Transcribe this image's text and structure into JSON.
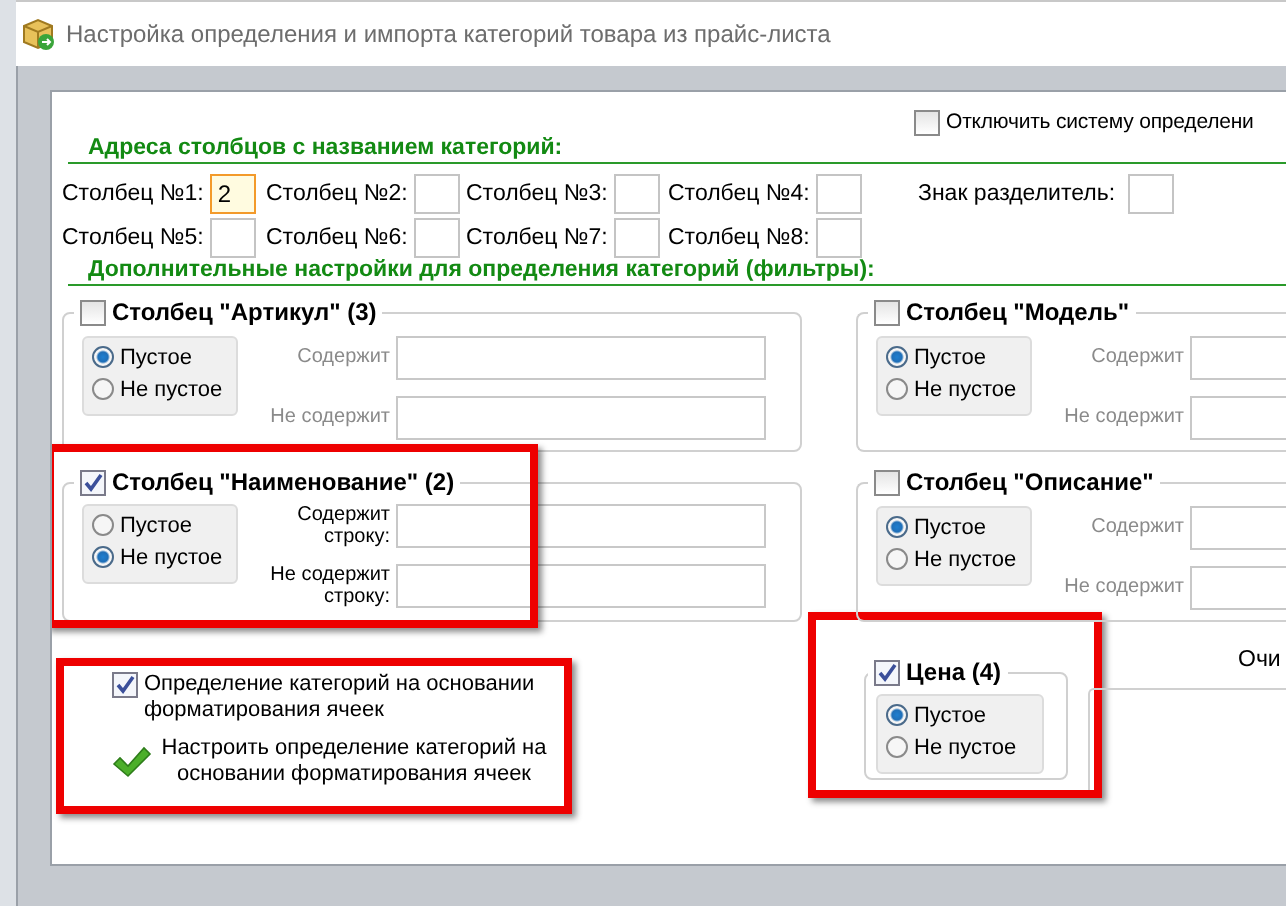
{
  "window": {
    "title": "Настройка определения и импорта категорий товара из прайс-листа"
  },
  "disable_detection": {
    "label": "Отключить систему определени",
    "checked": false
  },
  "columns_section": {
    "title": "Адреса столбцов с названием категорий:",
    "fields": [
      {
        "label": "Столбец №1:",
        "value": "2",
        "focused": true
      },
      {
        "label": "Столбец №2:",
        "focused": false
      },
      {
        "label": "Столбец №3:",
        "focused": false
      },
      {
        "label": "Столбец №4:",
        "focused": false
      },
      {
        "label": "Столбец №5:",
        "focused": false
      },
      {
        "label": "Столбец №6:",
        "focused": false
      },
      {
        "label": "Столбец №7:",
        "focused": false
      },
      {
        "label": "Столбец №8:",
        "focused": false
      }
    ],
    "separator": {
      "label": "Знак разделитель:"
    }
  },
  "filters_section": {
    "title": "Дополнительные настройки для определения категорий (фильтры):",
    "groups": [
      {
        "title": "Столбец \"Артикул\" (3)",
        "checked": false,
        "highlighted": false,
        "options": [
          {
            "label": "Пустое",
            "selected": true
          },
          {
            "label": "Не пустое",
            "selected": false
          }
        ],
        "fields": [
          {
            "label": "Содержит",
            "faded": true
          },
          {
            "label": "Не содержит",
            "faded": true
          }
        ]
      },
      {
        "title": "Столбец \"Модель\"",
        "checked": false,
        "highlighted": false,
        "options": [
          {
            "label": "Пустое",
            "selected": true
          },
          {
            "label": "Не пустое",
            "selected": false
          }
        ],
        "fields": [
          {
            "label": "Содержит",
            "faded": true
          },
          {
            "label": "Не содержит",
            "faded": true
          }
        ]
      },
      {
        "title": "Столбец \"Наименование\" (2)",
        "checked": true,
        "highlighted": true,
        "options": [
          {
            "label": "Пустое",
            "selected": false
          },
          {
            "label": "Не пустое",
            "selected": true
          }
        ],
        "fields": [
          {
            "label": "Содержит строку:",
            "faded": false
          },
          {
            "label": "Не содержит строку:",
            "faded": false
          }
        ]
      },
      {
        "title": "Столбец \"Описание\"",
        "checked": false,
        "highlighted": false,
        "options": [
          {
            "label": "Пустое",
            "selected": true
          },
          {
            "label": "Не пустое",
            "selected": false
          }
        ],
        "fields": [
          {
            "label": "Содержит",
            "faded": true
          },
          {
            "label": "Не содержит",
            "faded": true
          }
        ]
      }
    ]
  },
  "format_detection": {
    "highlighted": true,
    "checkbox": {
      "label": "Определение категорий на основании форматирования ячеек",
      "checked": true
    },
    "link": "Настроить определение категорий на основании форматирования ячеек"
  },
  "price_group": {
    "title": "Цена (4)",
    "checked": true,
    "highlighted": true,
    "options": [
      {
        "label": "Пустое",
        "selected": true
      },
      {
        "label": "Не пустое",
        "selected": false
      }
    ]
  },
  "column_3": {
    "label": "Очи"
  }
}
